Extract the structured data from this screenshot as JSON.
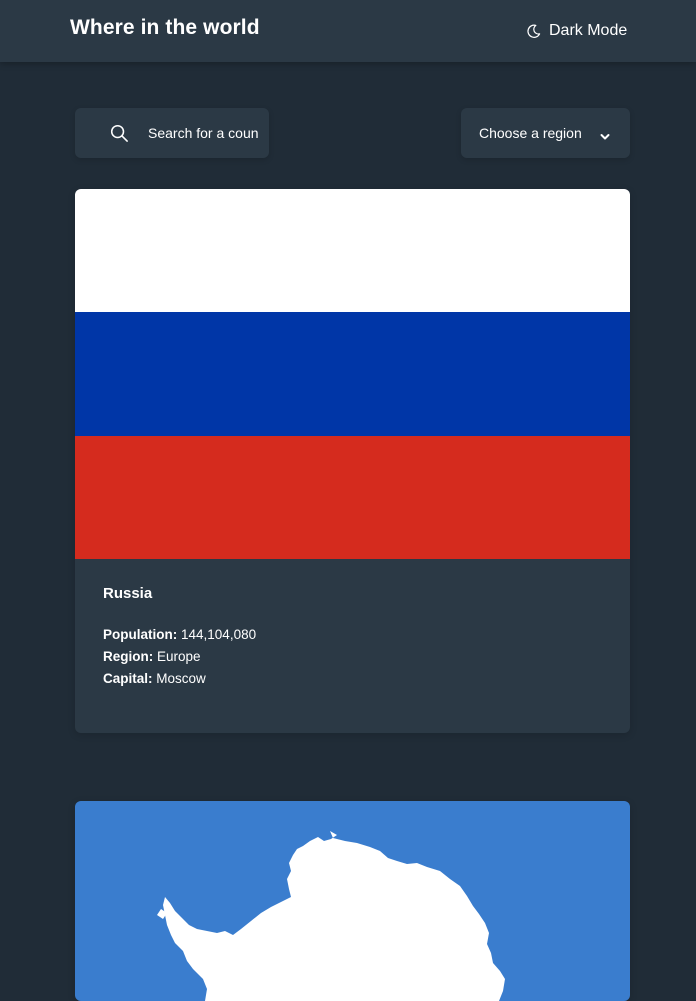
{
  "header": {
    "title": "Where in the world",
    "theme_toggle_label": "Dark Mode",
    "theme_icon": "moon-icon"
  },
  "search": {
    "placeholder": "Search for a country...",
    "icon": "search-icon"
  },
  "filter": {
    "label": "Choose a region",
    "icon": "chevron-down-icon"
  },
  "countries": [
    {
      "name": "Russia",
      "population_label": "Population:",
      "population": "144,104,080",
      "region_label": "Region:",
      "region": "Europe",
      "capital_label": "Capital:",
      "capital": "Moscow",
      "flag_colors": [
        "#ffffff",
        "#0036a7",
        "#d52b1e"
      ]
    },
    {
      "flag_colors": [
        "#3a7dce",
        "#ffffff"
      ]
    }
  ],
  "colors": {
    "background": "#202c37",
    "surface": "#2b3945",
    "text": "#ffffff"
  }
}
